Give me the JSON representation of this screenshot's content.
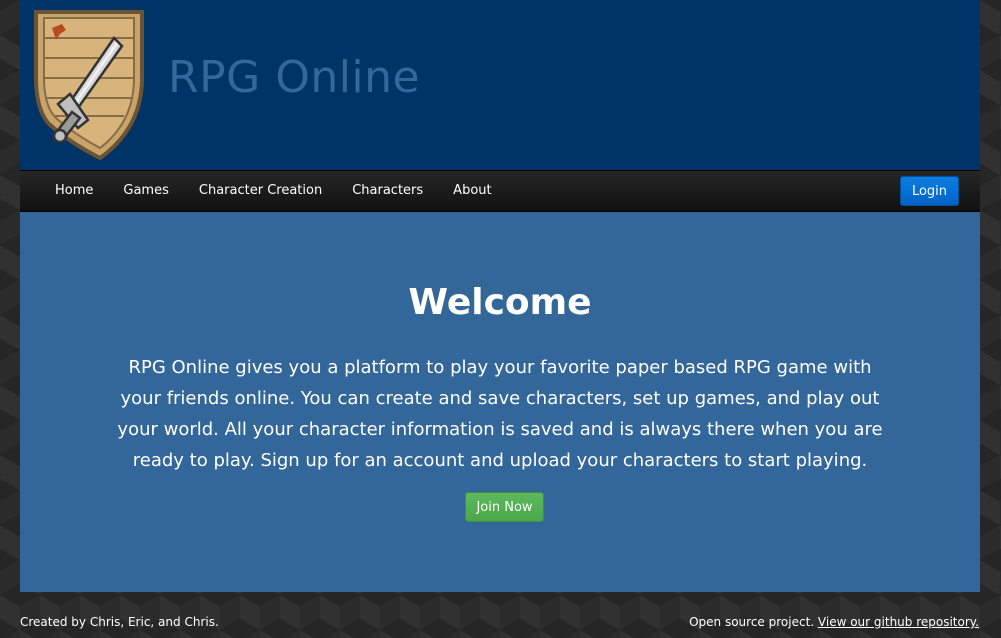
{
  "header": {
    "title": "RPG Online"
  },
  "nav": {
    "items": [
      {
        "label": "Home"
      },
      {
        "label": "Games"
      },
      {
        "label": "Character Creation"
      },
      {
        "label": "Characters"
      },
      {
        "label": "About"
      }
    ],
    "login_label": "Login"
  },
  "main": {
    "heading": "Welcome",
    "intro": "RPG Online gives you a platform to play your favorite paper based RPG game with your friends online. You can create and save characters, set up games, and play out your world. All your character information is saved and is always there when you are ready to play. Sign up for an account and upload your characters to start playing.",
    "join_label": "Join Now"
  },
  "footer": {
    "credits": "Created by Chris, Eric, and Chris.",
    "open_source_text": "Open source project.",
    "github_link": "View our github repository."
  },
  "colors": {
    "header_bg": "#003366",
    "title_color": "#34679a",
    "main_bg": "#336699",
    "login_button": "#0a74da",
    "join_button": "#5cb85c"
  },
  "icons": {
    "logo": "shield-with-sword-icon"
  }
}
